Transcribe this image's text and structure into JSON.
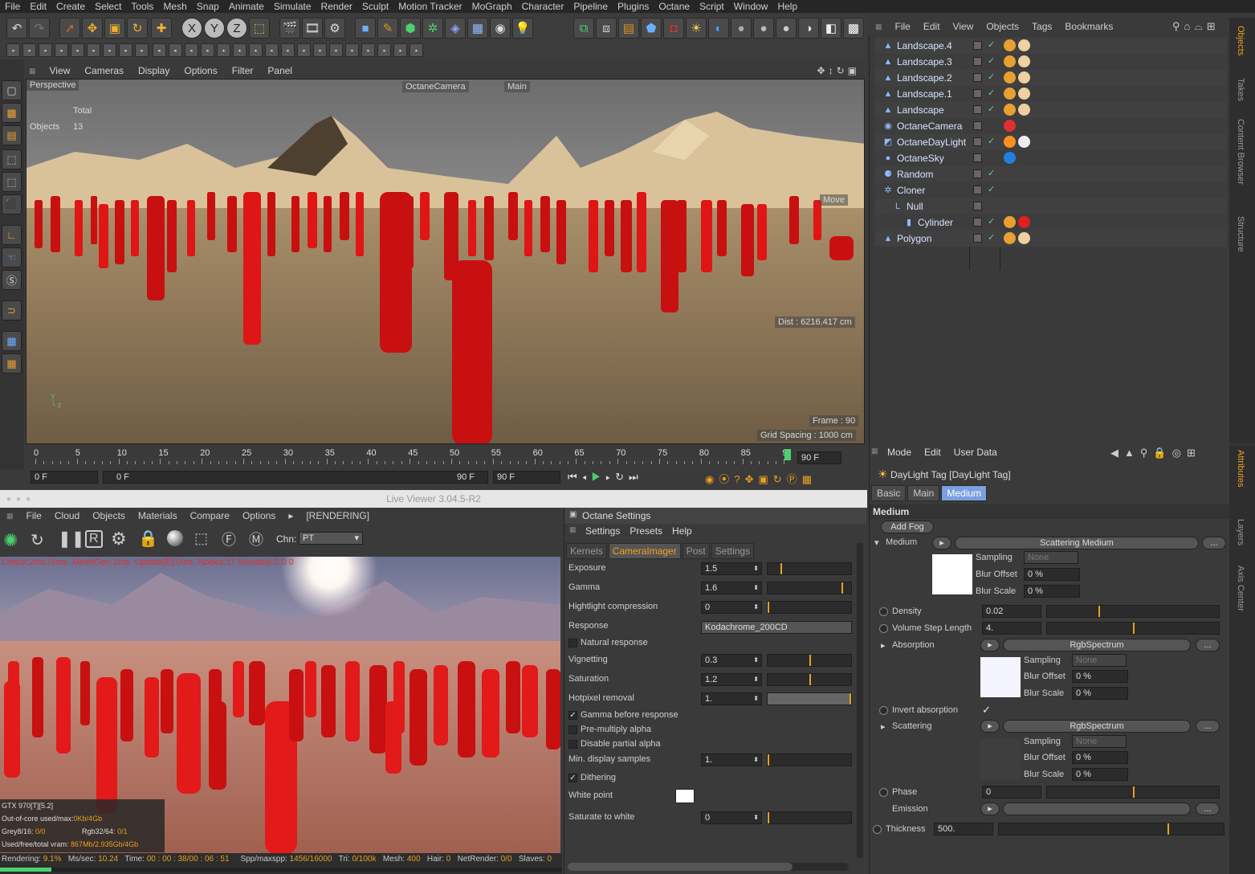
{
  "menubar": [
    "File",
    "Edit",
    "Create",
    "Select",
    "Tools",
    "Mesh",
    "Snap",
    "Animate",
    "Simulate",
    "Render",
    "Sculpt",
    "Motion Tracker",
    "MoGraph",
    "Character",
    "Pipeline",
    "Plugins",
    "Octane",
    "Script",
    "Window",
    "Help"
  ],
  "viewport": {
    "menu": [
      "View",
      "Cameras",
      "Display",
      "Options",
      "Filter",
      "Panel"
    ],
    "name": "Perspective",
    "camera": "OctaneCamera",
    "main": "Main",
    "stats_header": "Total",
    "stats_label": "Objects",
    "stats_value": "13",
    "move_label": "Move",
    "dist": "Dist : 6216.417 cm",
    "frame": "Frame : 90",
    "grid": "Grid Spacing : 1000 cm"
  },
  "timeline": {
    "ticks": [
      "0",
      "5",
      "10",
      "15",
      "20",
      "25",
      "30",
      "35",
      "40",
      "45",
      "50",
      "55",
      "60",
      "65",
      "70",
      "75",
      "80",
      "85",
      "9"
    ],
    "end_frame": "90 F",
    "current": "0 F",
    "range_start": "0 F",
    "range_end": "90 F",
    "max": "90 F"
  },
  "liveviewer": {
    "title": "Live Viewer 3.04.5-R2",
    "menu": [
      "File",
      "Cloud",
      "Objects",
      "Materials",
      "Compare",
      "Options"
    ],
    "status": "[RENDERING]",
    "channel_label": "Chn:",
    "channel_value": "PT",
    "debug": "Check:2ms./3ms. MeshGen:1ms. Update[E]:0ms. Nodes:17 Movable:0  0 0",
    "gpu": "GTX 970[T][5.2]",
    "outofcore_label": "Out-of-core used/max:",
    "outofcore_value": "0Kb/4Gb",
    "grey_label": "Grey8/16:",
    "grey_value": "0/0",
    "rgb_label": "Rgb32/64:",
    "rgb_value": "0/1",
    "vram_label": "Used/free/total vram:",
    "vram_value": "867Mb/2.935Gb/4Gb",
    "footer": {
      "rendering_label": "Rendering:",
      "rendering_value": "9.1%",
      "ms_label": "Ms/sec:",
      "ms_value": "10.24",
      "time_label": "Time:",
      "time_value": "00 : 00 : 38/00 : 06 : 51",
      "spp_label": "Spp/maxspp:",
      "spp_value": "1456/16000",
      "tri_label": "Tri:",
      "tri_value": "0/100k",
      "mesh_label": "Mesh:",
      "mesh_value": "400",
      "hair_label": "Hair:",
      "hair_value": "0",
      "net_label": "NetRender:",
      "net_value": "0/0",
      "slaves_label": "Slaves:",
      "slaves_value": "0"
    },
    "progress": 0.091
  },
  "octane": {
    "title": "Octane Settings",
    "menu": [
      "Settings",
      "Presets",
      "Help"
    ],
    "tabs": [
      "Kernels",
      "CameraImager",
      "Post",
      "Settings"
    ],
    "active_tab": "CameraImager",
    "rows": [
      {
        "label": "Exposure",
        "value": "1.5",
        "fill": 0.15
      },
      {
        "label": "Gamma",
        "value": "1.6",
        "fill": 0.88
      },
      {
        "label": "Hightlight compression",
        "value": "0",
        "fill": 0.0
      },
      {
        "label": "Vignetting",
        "value": "0.3",
        "fill": 0.5
      },
      {
        "label": "Saturation",
        "value": "1.2",
        "fill": 0.5
      },
      {
        "label": "Hotpixel removal",
        "value": "1.",
        "fill": 1.0
      },
      {
        "label": "Min. display samples",
        "value": "1.",
        "fill": 0.0
      },
      {
        "label": "Saturate to white",
        "value": "0",
        "fill": 0.0
      }
    ],
    "response_label": "Response",
    "response_value": "Kodachrome_200CD",
    "natural_response": "Natural response",
    "gamma_before": "Gamma before response",
    "premultiply": "Pre-multiply alpha",
    "disable_partial": "Disable partial alpha",
    "dithering": "Dithering",
    "white_point": "White point"
  },
  "objects": {
    "menu": [
      "File",
      "Edit",
      "View",
      "Objects",
      "Tags",
      "Bookmarks"
    ],
    "items": [
      {
        "name": "Landscape.4",
        "icon": "landscape-icon"
      },
      {
        "name": "Landscape.3",
        "icon": "landscape-icon"
      },
      {
        "name": "Landscape.2",
        "icon": "landscape-icon"
      },
      {
        "name": "Landscape.1",
        "icon": "landscape-icon"
      },
      {
        "name": "Landscape",
        "icon": "landscape-icon"
      },
      {
        "name": "OctaneCamera",
        "icon": "camera-icon"
      },
      {
        "name": "OctaneDayLight",
        "icon": "daylight-icon"
      },
      {
        "name": "OctaneSky",
        "icon": "sky-icon"
      },
      {
        "name": "Random",
        "icon": "random-icon"
      },
      {
        "name": "Cloner",
        "icon": "cloner-icon"
      },
      {
        "name": "Null",
        "icon": "null-icon"
      },
      {
        "name": "Cylinder",
        "icon": "cylinder-icon"
      },
      {
        "name": "Polygon",
        "icon": "polygon-icon"
      }
    ]
  },
  "sidetabs_top": [
    "Objects",
    "Takes",
    "Content Browser",
    "Structure"
  ],
  "sidetabs_bottom": [
    "Attributes",
    "Layers",
    "Axis Center"
  ],
  "attributes": {
    "menu": [
      "Mode",
      "Edit",
      "User Data"
    ],
    "title": "DayLight Tag [DayLight Tag]",
    "tabs": [
      "Basic",
      "Main",
      "Medium"
    ],
    "active_tab": "Medium",
    "section": "Medium",
    "add_fog": "Add Fog",
    "medium_label": "Medium",
    "medium_value": "Scattering Medium",
    "sampling": "Sampling",
    "sampling_value": "None",
    "blur_offset": "Blur Offset",
    "blur_offset_value": "0 %",
    "blur_scale": "Blur Scale",
    "blur_scale_value": "0 %",
    "density_label": "Density",
    "density_value": "0.02",
    "volume_step_label": "Volume Step Length",
    "volume_step_value": "4.",
    "absorption_label": "Absorption",
    "absorption_value": "RgbSpectrum",
    "invert_absorption": "Invert absorption",
    "scattering_label": "Scattering",
    "scattering_value": "RgbSpectrum",
    "phase_label": "Phase",
    "phase_value": "0",
    "emission_label": "Emission",
    "thickness_label": "Thickness",
    "thickness_value": "500.",
    "ellipsis": "...",
    "density_fill": 0.3,
    "volume_fill": 0.5,
    "phase_fill": 0.5,
    "thickness_fill": 0.75
  }
}
